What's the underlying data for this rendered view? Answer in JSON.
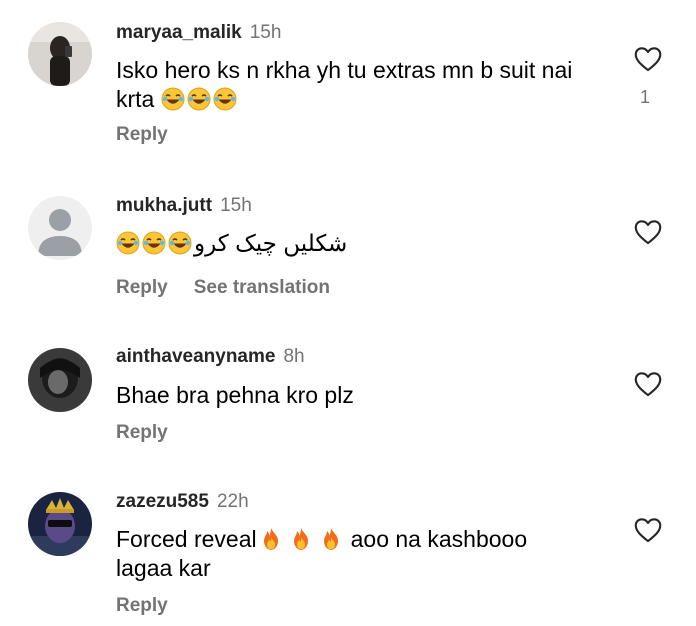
{
  "comments": [
    {
      "username": "maryaa_malik",
      "time": "15h",
      "text_line1": "Isko hero ks n rkha yh tu extras mn b suit nai",
      "text_line2": "krta",
      "emojis": [
        "laughing-emoji",
        "laughing-emoji",
        "laughing-emoji"
      ],
      "reply_label": "Reply",
      "like_count": "1"
    },
    {
      "username": "mukha.jutt",
      "time": "15h",
      "text": "شکلیں چیک کرو",
      "emojis": [
        "laughing-emoji",
        "laughing-emoji",
        "laughing-emoji"
      ],
      "reply_label": "Reply",
      "translate_label": "See translation"
    },
    {
      "username": "ainthaveanyname",
      "time": "8h",
      "text": "Bhae bra pehna kro plz",
      "reply_label": "Reply"
    },
    {
      "username": "zazezu585",
      "time": "22h",
      "text_before": "Forced reveal",
      "emojis": [
        "fire-emoji",
        "fire-emoji",
        "fire-emoji"
      ],
      "text_after": "aoo na kashbooo",
      "text_line2": "lagaa kar",
      "reply_label": "Reply"
    }
  ],
  "colors": {
    "secondary_text": "#737373",
    "username": "#262626",
    "default_avatar_bg": "#efefef",
    "default_avatar_fg": "#9aa0a6"
  }
}
